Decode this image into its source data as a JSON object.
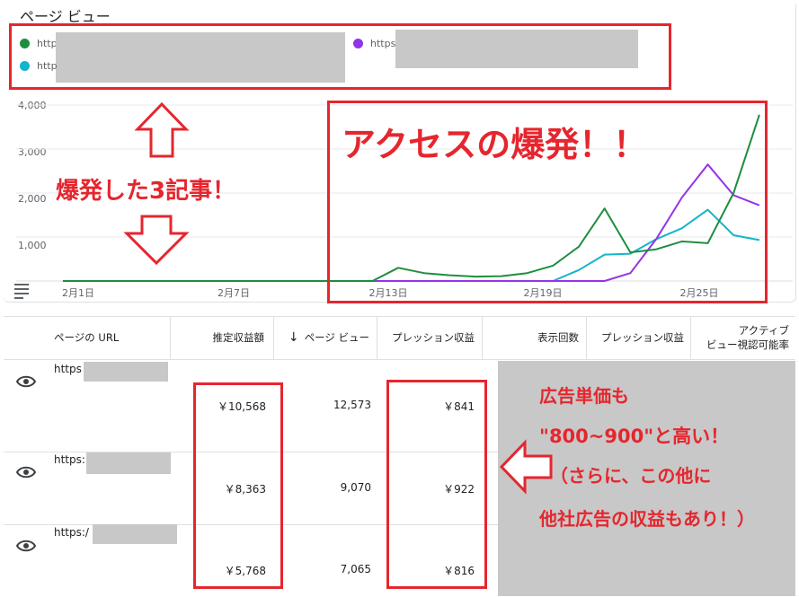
{
  "header": {
    "title": "ページ ビュー"
  },
  "legend": [
    {
      "label": "http",
      "color": "#1e8e3e"
    },
    {
      "label": "https",
      "color": "#9334e6"
    },
    {
      "label": "http",
      "color": "#12b5cb"
    }
  ],
  "annotations": {
    "access_burst": "アクセスの爆発！！",
    "three_articles": "爆発した3記事！",
    "callout_line1": "広告単価も",
    "callout_line2": "\"800~900\"と高い！",
    "callout_line3": "（さらに、この他に",
    "callout_line4": "他社広告の収益もあり！）"
  },
  "chart_data": {
    "type": "line",
    "title": "ページ ビュー",
    "xlabel": "",
    "ylabel": "",
    "ylim": [
      0,
      4000
    ],
    "y_ticks": [
      "4,000",
      "3,000",
      "2,000",
      "1,000"
    ],
    "x_tick_labels": [
      "2月1日",
      "2月7日",
      "2月13日",
      "2月19日",
      "2月25日"
    ],
    "x": [
      "2月1日",
      "2月2日",
      "2月3日",
      "2月4日",
      "2月5日",
      "2月6日",
      "2月7日",
      "2月8日",
      "2月9日",
      "2月10日",
      "2月11日",
      "2月12日",
      "2月13日",
      "2月14日",
      "2月15日",
      "2月16日",
      "2月17日",
      "2月18日",
      "2月19日",
      "2月20日",
      "2月21日",
      "2月22日",
      "2月23日",
      "2月24日",
      "2月25日",
      "2月26日",
      "2月27日"
    ],
    "series": [
      {
        "color": "#1e8e3e",
        "values": [
          0,
          0,
          0,
          0,
          0,
          0,
          0,
          0,
          0,
          0,
          0,
          0,
          0,
          300,
          180,
          130,
          100,
          110,
          180,
          350,
          780,
          1650,
          650,
          720,
          900,
          860,
          2000,
          3780
        ]
      },
      {
        "color": "#9334e6",
        "values": [
          0,
          0,
          0,
          0,
          0,
          0,
          0,
          0,
          0,
          0,
          0,
          0,
          0,
          0,
          0,
          0,
          0,
          0,
          0,
          0,
          0,
          0,
          180,
          950,
          1900,
          2650,
          1950,
          1720
        ]
      },
      {
        "color": "#12b5cb",
        "values": [
          0,
          0,
          0,
          0,
          0,
          0,
          0,
          0,
          0,
          0,
          0,
          0,
          0,
          0,
          0,
          0,
          0,
          0,
          0,
          0,
          250,
          600,
          620,
          950,
          1200,
          1620,
          1040,
          930
        ]
      }
    ],
    "grid": true,
    "legend_position": "top"
  },
  "table": {
    "headers": {
      "url": "ページの URL",
      "revenue": "推定収益額",
      "pageviews": "ページ ビュー",
      "impression_revenue": "プレッション収益",
      "impressions": "表示回数",
      "impression_revenue2": "プレッション収益",
      "active_view_line1": "アクティブ",
      "active_view_line2": "ビュー視認可能率"
    },
    "sort_icon": "arrow-down-icon",
    "rows": [
      {
        "url": "https",
        "revenue": "￥10,568",
        "pageviews": "12,573",
        "impression_revenue": "￥841"
      },
      {
        "url": "https:",
        "revenue": "￥8,363",
        "pageviews": "9,070",
        "impression_revenue": "￥922"
      },
      {
        "url": "https:/",
        "revenue": "￥5,768",
        "pageviews": "7,065",
        "impression_revenue": "￥816"
      }
    ]
  },
  "colors": {
    "accent_red": "#e5262e",
    "redaction_gray": "#c8c8c8"
  }
}
